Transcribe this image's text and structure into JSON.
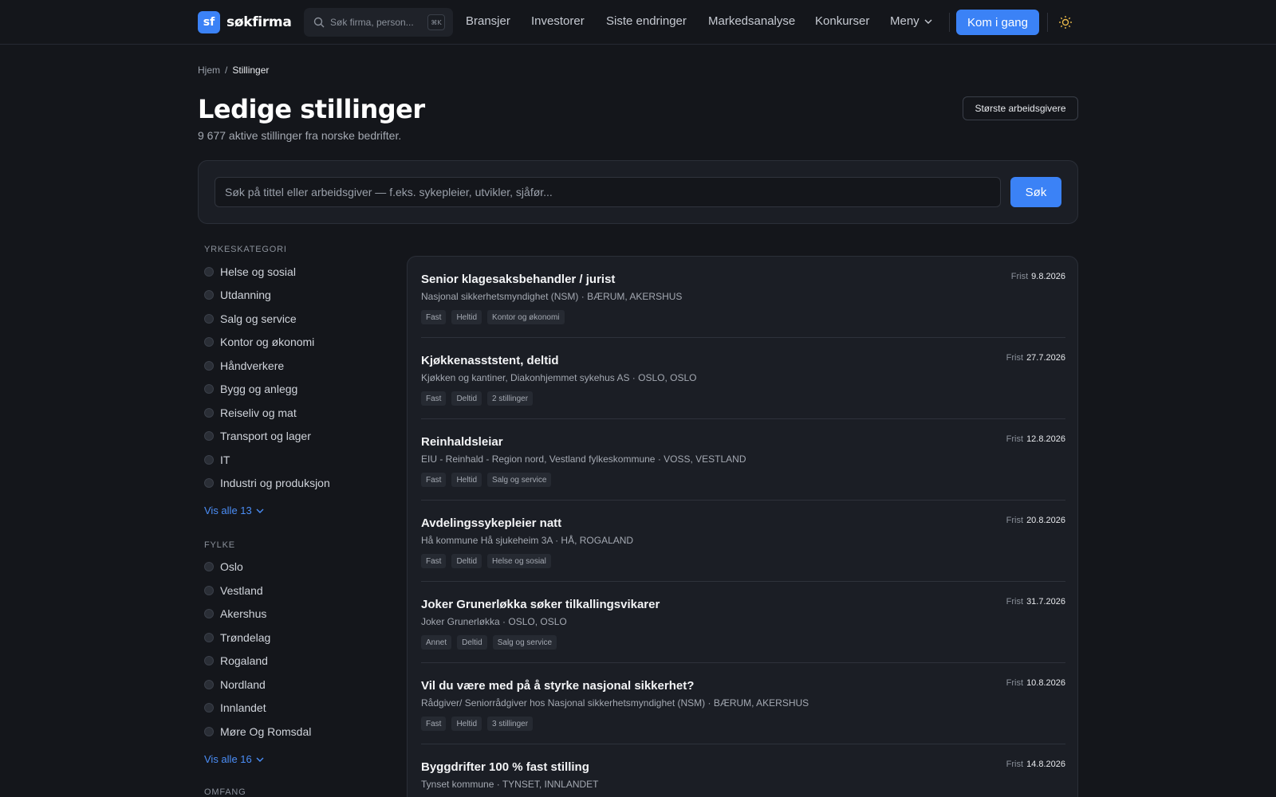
{
  "nav": {
    "logo_badge": "sf",
    "logo_text": "søkfirma",
    "search_placeholder": "Søk firma, person...",
    "search_shortcut": "⌘K",
    "links": [
      "Bransjer",
      "Investorer",
      "Siste endringer",
      "Markedsanalyse",
      "Konkurser"
    ],
    "menu_label": "Meny",
    "cta_label": "Kom i gang",
    "theme_icon": "sun-icon"
  },
  "breadcrumb": {
    "home": "Hjem",
    "separator": "/",
    "current": "Stillinger"
  },
  "header": {
    "title": "Ledige stillinger",
    "subtitle": "9 677 aktive stillinger fra norske bedrifter.",
    "employers_button": "Største arbeidsgivere"
  },
  "search": {
    "placeholder": "Søk på tittel eller arbeidsgiver — f.eks. sykepleier, utvikler, sjåfør...",
    "button": "Søk"
  },
  "filters": {
    "category": {
      "heading": "YRKESKATEGORI",
      "options": [
        "Helse og sosial",
        "Utdanning",
        "Salg og service",
        "Kontor og økonomi",
        "Håndverkere",
        "Bygg og anlegg",
        "Reiseliv og mat",
        "Transport og lager",
        "IT",
        "Industri og produksjon"
      ],
      "show_all": "Vis alle 13"
    },
    "county": {
      "heading": "FYLKE",
      "options": [
        "Oslo",
        "Vestland",
        "Akershus",
        "Trøndelag",
        "Rogaland",
        "Nordland",
        "Innlandet",
        "Møre Og Romsdal"
      ],
      "show_all": "Vis alle 16"
    },
    "scope": {
      "heading": "OMFANG"
    }
  },
  "jobs": {
    "deadline_label": "Frist",
    "items": [
      {
        "title": "Senior klagesaksbehandler / jurist",
        "meta": "Nasjonal sikkerhetsmyndighet (NSM) · BÆRUM, AKERSHUS",
        "tags": [
          "Fast",
          "Heltid",
          "Kontor og økonomi"
        ],
        "deadline": "9.8.2026"
      },
      {
        "title": "Kjøkkenasststent, deltid",
        "meta": "Kjøkken og kantiner, Diakonhjemmet sykehus AS · OSLO, OSLO",
        "tags": [
          "Fast",
          "Deltid",
          "2 stillinger"
        ],
        "deadline": "27.7.2026"
      },
      {
        "title": "Reinhaldsleiar",
        "meta": "EIU - Reinhald - Region nord, Vestland fylkeskommune · VOSS, VESTLAND",
        "tags": [
          "Fast",
          "Heltid",
          "Salg og service"
        ],
        "deadline": "12.8.2026"
      },
      {
        "title": "Avdelingssykepleier natt",
        "meta": "Hå kommune Hå sjukeheim 3A · HÅ, ROGALAND",
        "tags": [
          "Fast",
          "Deltid",
          "Helse og sosial"
        ],
        "deadline": "20.8.2026"
      },
      {
        "title": "Joker Grunerløkka søker tilkallingsvikarer",
        "meta": "Joker Grunerløkka · OSLO, OSLO",
        "tags": [
          "Annet",
          "Deltid",
          "Salg og service"
        ],
        "deadline": "31.7.2026"
      },
      {
        "title": "Vil du være med på å styrke nasjonal sikkerhet?",
        "meta": "Rådgiver/ Seniorrådgiver hos Nasjonal sikkerhetsmyndighet (NSM) · BÆRUM, AKERSHUS",
        "tags": [
          "Fast",
          "Heltid",
          "3 stillinger"
        ],
        "deadline": "10.8.2026"
      },
      {
        "title": "Byggdrifter 100 % fast stilling",
        "meta": "Tynset kommune · TYNSET, INNLANDET",
        "tags": [],
        "deadline": "14.8.2026"
      }
    ]
  },
  "colors": {
    "accent": "#3b82f6",
    "background": "#14161b",
    "panel": "#1b1e25"
  }
}
